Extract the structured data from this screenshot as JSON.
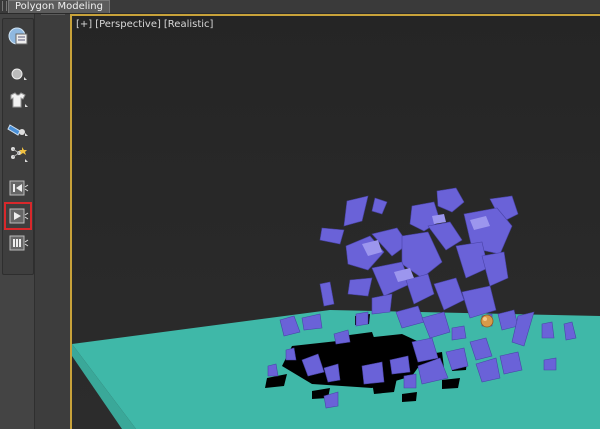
{
  "ribbon": {
    "tab_label": "Polygon Modeling"
  },
  "viewport": {
    "label_plus": "[+]",
    "label_view": "[Perspective]",
    "label_shading": "[Realistic]"
  },
  "toolbar": {
    "icons": [
      "display-panel-icon",
      "sphere-icon",
      "shirt-icon",
      "mass-fx-icon",
      "constraint-icon",
      "reset-simulation-icon",
      "play-simulation-icon",
      "step-simulation-icon"
    ],
    "selected": "play-simulation-icon"
  },
  "colors": {
    "ground": "#3fb8a8",
    "fragments": "#6a62d8",
    "shadow": "#000000",
    "sphere": "#d89a4a",
    "selection": "#d8282b",
    "viewport_border": "#c8a23a"
  }
}
